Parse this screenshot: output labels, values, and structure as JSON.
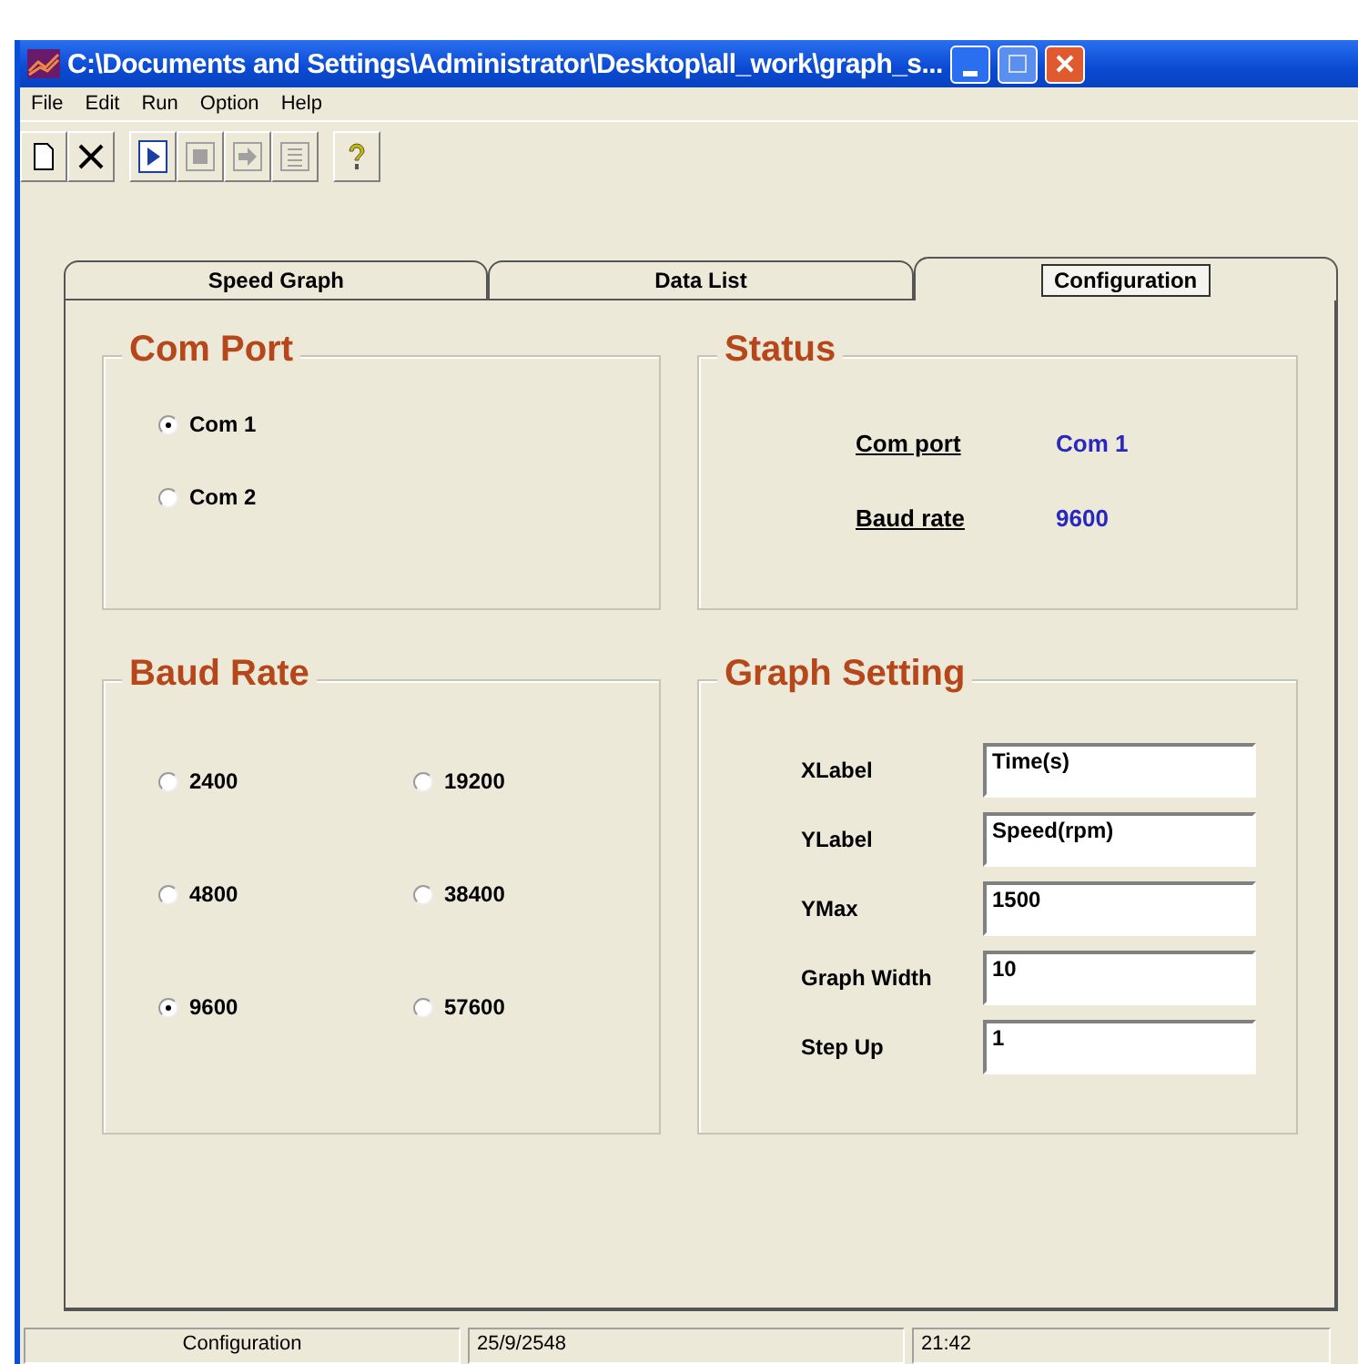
{
  "window": {
    "title": "C:\\Documents and Settings\\Administrator\\Desktop\\all_work\\graph_s..."
  },
  "menu": [
    "File",
    "Edit",
    "Run",
    "Option",
    "Help"
  ],
  "toolbar": [
    {
      "kind": "new",
      "disabled": false
    },
    {
      "kind": "delete",
      "disabled": false
    },
    {
      "kind": "run",
      "disabled": false
    },
    {
      "kind": "stop",
      "disabled": true
    },
    {
      "kind": "step",
      "disabled": true
    },
    {
      "kind": "list",
      "disabled": true
    },
    {
      "kind": "help",
      "disabled": false
    }
  ],
  "tabs": [
    {
      "label": "Speed Graph",
      "selected": false
    },
    {
      "label": "Data List",
      "selected": false
    },
    {
      "label": "Configuration",
      "selected": true
    }
  ],
  "com_port": {
    "title": "Com Port",
    "options": [
      {
        "label": "Com 1",
        "selected": true
      },
      {
        "label": "Com 2",
        "selected": false
      }
    ]
  },
  "status": {
    "title": "Status",
    "rows": [
      {
        "label": "Com port",
        "value": "Com 1"
      },
      {
        "label": "Baud rate",
        "value": "9600"
      }
    ]
  },
  "baud_rate": {
    "title": "Baud Rate",
    "options": [
      {
        "label": "2400",
        "selected": false
      },
      {
        "label": "19200",
        "selected": false
      },
      {
        "label": "4800",
        "selected": false
      },
      {
        "label": "38400",
        "selected": false
      },
      {
        "label": "9600",
        "selected": true
      },
      {
        "label": "57600",
        "selected": false
      }
    ]
  },
  "graph_setting": {
    "title": "Graph Setting",
    "fields": [
      {
        "label": "XLabel",
        "value": "Time(s)"
      },
      {
        "label": "YLabel",
        "value": "Speed(rpm)"
      },
      {
        "label": "YMax",
        "value": "1500"
      },
      {
        "label": "Graph Width",
        "value": "10"
      },
      {
        "label": "Step Up",
        "value": "1"
      }
    ]
  },
  "status_bar": [
    "Configuration",
    "25/9/2548",
    "21:42"
  ]
}
